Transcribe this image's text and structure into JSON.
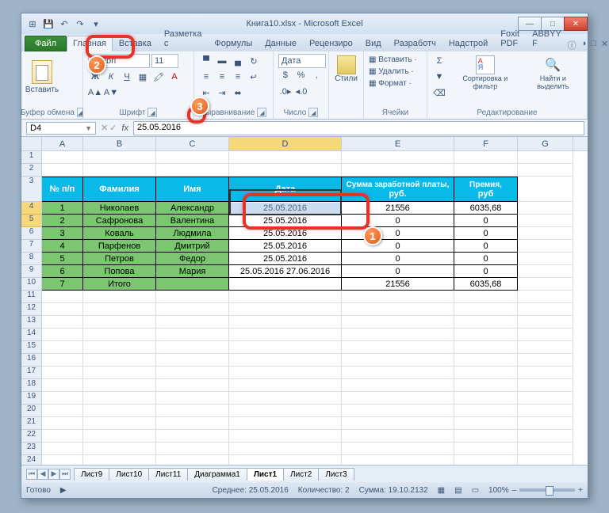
{
  "window": {
    "title": "Книга10.xlsx - Microsoft Excel"
  },
  "qat": {
    "save": "💾",
    "undo": "↶",
    "redo": "↷",
    "more": "▾"
  },
  "winbtns": {
    "min": "—",
    "max": "□",
    "close": "✕"
  },
  "tabs": {
    "file": "Файл",
    "items": [
      "Главная",
      "Вставка",
      "Разметка с",
      "Формулы",
      "Данные",
      "Рецензиро",
      "Вид",
      "Разработч",
      "Надстрой",
      "Foxit PDF",
      "ABBYY F"
    ],
    "active": 0,
    "right": [
      "ⓘ",
      "◑",
      "□",
      "✕"
    ]
  },
  "ribbon": {
    "clipboard": {
      "paste": "Вставить",
      "label": "Буфер обмена"
    },
    "font": {
      "family": "Calibri",
      "size": "11",
      "label": "Шрифт",
      "bold": "Ж",
      "italic": "К",
      "underline": "Ч"
    },
    "align": {
      "label": "Выравнивание"
    },
    "number": {
      "fmt": "Дата",
      "label": "Число"
    },
    "styles": {
      "btn": "Стили",
      "label": ""
    },
    "cells": {
      "insert": "Вставить ·",
      "delete": "Удалить ·",
      "format": "Формат ·",
      "label": "Ячейки"
    },
    "editing": {
      "sort": "Сортировка и фильтр",
      "find": "Найти и выделить",
      "label": "Редактирование"
    }
  },
  "namebox": "D4",
  "formula": "25.05.2016",
  "cols": [
    "A",
    "B",
    "C",
    "D",
    "E",
    "F",
    "G"
  ],
  "rows_vis": 27,
  "table": {
    "header1": [
      "",
      "",
      "",
      "",
      "Сумма заработной платы,",
      "Премия,"
    ],
    "header2": [
      "№ п/п",
      "Фамилия",
      "Имя",
      "Дата",
      "руб.",
      "руб"
    ],
    "rows": [
      [
        "1",
        "Николаев",
        "Александр",
        "25.05.2016",
        "21556",
        "6035,68"
      ],
      [
        "2",
        "Сафронова",
        "Валентина",
        "25.05.2016",
        "0",
        "0"
      ],
      [
        "3",
        "Коваль",
        "Людмила",
        "25.05.2016",
        "0",
        "0"
      ],
      [
        "4",
        "Парфенов",
        "Дмитрий",
        "25.05.2016",
        "0",
        "0"
      ],
      [
        "5",
        "Петров",
        "Федор",
        "25.05.2016",
        "0",
        "0"
      ],
      [
        "6",
        "Попова",
        "Мария",
        "25.05.2016 27.06.2016",
        "0",
        "0"
      ],
      [
        "7",
        "Итого",
        "",
        "",
        "21556",
        "6035,68"
      ]
    ]
  },
  "sheets": {
    "nav": [
      "⏮",
      "◀",
      "▶",
      "⏭"
    ],
    "tabs": [
      "Лист9",
      "Лист10",
      "Лист11",
      "Диаграмма1",
      "Лист1",
      "Лист2",
      "Лист3"
    ],
    "active": 4
  },
  "status": {
    "ready": "Готово",
    "avg": "Среднее: 25.05.2016",
    "count": "Количество: 2",
    "sum": "Сумма: 19.10.2132",
    "zoom": "100%",
    "plus": "+",
    "minus": "–"
  },
  "callouts": {
    "n1": "1",
    "n2": "2",
    "n3": "3"
  },
  "chart_data": {
    "type": "table",
    "columns": [
      "№ п/п",
      "Фамилия",
      "Имя",
      "Дата",
      "Сумма заработной платы, руб.",
      "Премия, руб"
    ],
    "rows": [
      [
        1,
        "Николаев",
        "Александр",
        "25.05.2016",
        21556,
        6035.68
      ],
      [
        2,
        "Сафронова",
        "Валентина",
        "25.05.2016",
        0,
        0
      ],
      [
        3,
        "Коваль",
        "Людмила",
        "25.05.2016",
        0,
        0
      ],
      [
        4,
        "Парфенов",
        "Дмитрий",
        "25.05.2016",
        0,
        0
      ],
      [
        5,
        "Петров",
        "Федор",
        "25.05.2016",
        0,
        0
      ],
      [
        6,
        "Попова",
        "Мария",
        "25.05.2016 27.06.2016",
        0,
        0
      ],
      [
        7,
        "Итого",
        "",
        "",
        21556,
        6035.68
      ]
    ]
  }
}
